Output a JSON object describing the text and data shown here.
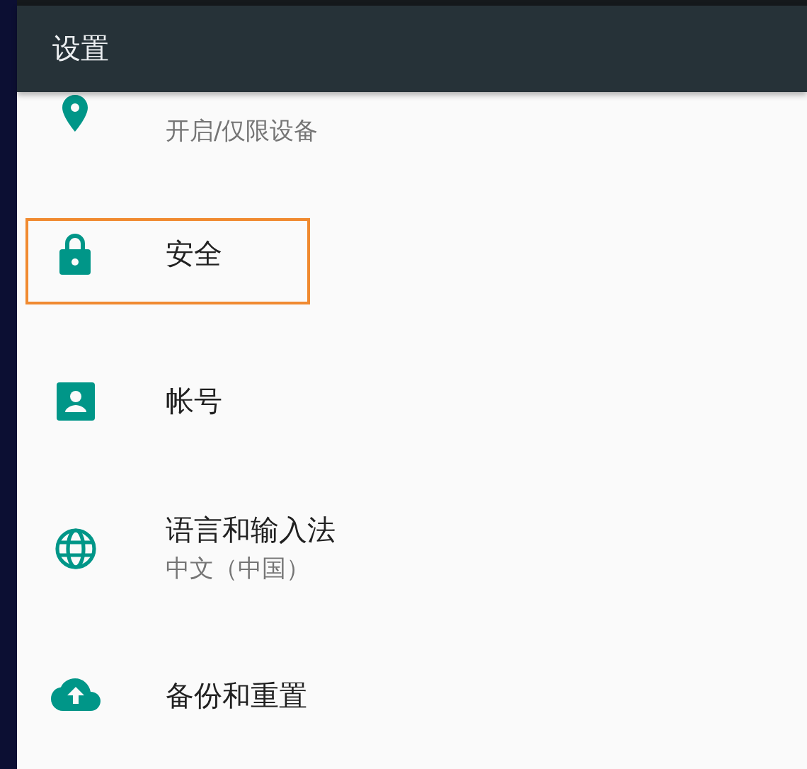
{
  "app_bar": {
    "title": "设置"
  },
  "items": [
    {
      "kind": "location",
      "summary": "开启/仅限设备",
      "highlighted": false
    },
    {
      "kind": "lock",
      "title": "安全",
      "highlighted": true
    },
    {
      "kind": "account",
      "title": "帐号",
      "highlighted": false
    },
    {
      "kind": "language",
      "title": "语言和输入法",
      "summary": "中文（中国）",
      "highlighted": false
    },
    {
      "kind": "backup",
      "title": "备份和重置",
      "highlighted": false
    }
  ]
}
